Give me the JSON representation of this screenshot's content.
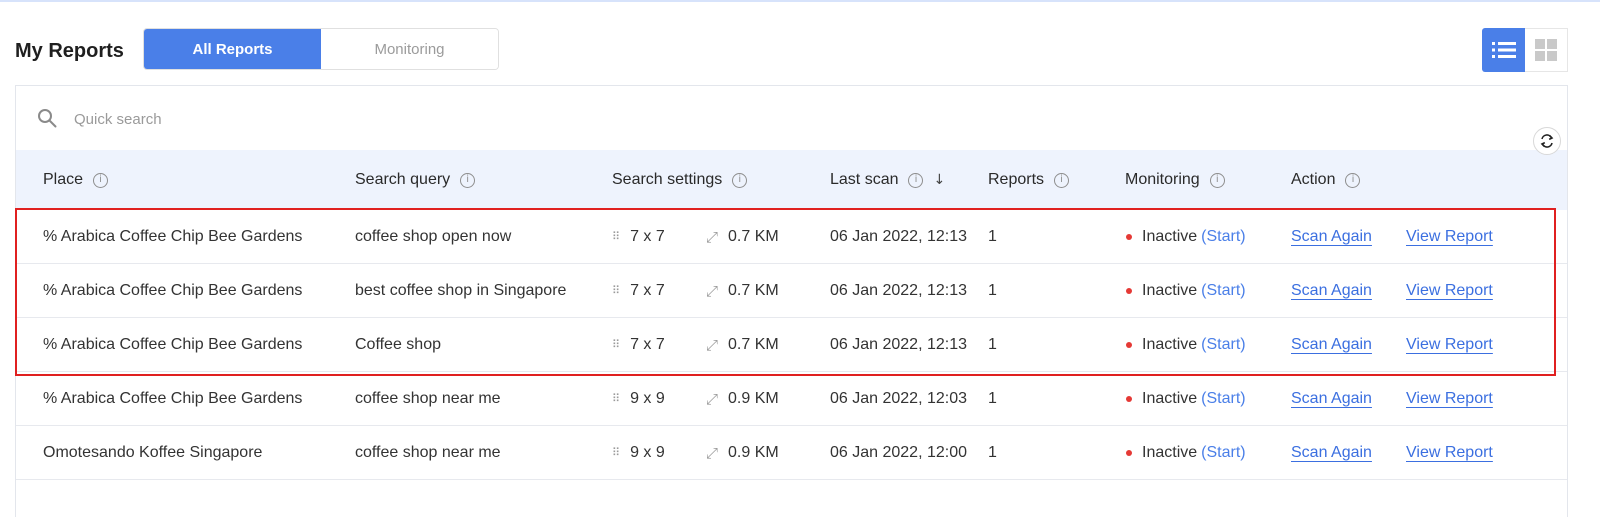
{
  "page": {
    "title": "My Reports"
  },
  "tabs": [
    {
      "label": "All Reports",
      "active": true
    },
    {
      "label": "Monitoring",
      "active": false
    }
  ],
  "view_toggle": {
    "list_icon": "list-view-icon",
    "grid_icon": "grid-view-icon",
    "active": "list"
  },
  "search": {
    "placeholder": "Quick search",
    "value": ""
  },
  "columns": [
    {
      "key": "place",
      "label": "Place"
    },
    {
      "key": "query",
      "label": "Search query"
    },
    {
      "key": "settings",
      "label": "Search settings"
    },
    {
      "key": "last_scan",
      "label": "Last scan",
      "sorted": "desc"
    },
    {
      "key": "reports",
      "label": "Reports"
    },
    {
      "key": "monitoring",
      "label": "Monitoring"
    },
    {
      "key": "action",
      "label": "Action"
    }
  ],
  "rows": [
    {
      "place": "% Arabica Coffee Chip Bee Gardens",
      "query": "coffee shop open now",
      "grid": "7 x 7",
      "radius": "0.7 KM",
      "last_scan": "06 Jan 2022, 12:13",
      "reports": "1",
      "status": "Inactive",
      "start": "(Start)",
      "scan_again": "Scan Again",
      "view_report": "View Report"
    },
    {
      "place": "% Arabica Coffee Chip Bee Gardens",
      "query": "best coffee shop in Singapore",
      "grid": "7 x 7",
      "radius": "0.7 KM",
      "last_scan": "06 Jan 2022, 12:13",
      "reports": "1",
      "status": "Inactive",
      "start": "(Start)",
      "scan_again": "Scan Again",
      "view_report": "View Report"
    },
    {
      "place": "% Arabica Coffee Chip Bee Gardens",
      "query": "Coffee shop",
      "grid": "7 x 7",
      "radius": "0.7 KM",
      "last_scan": "06 Jan 2022, 12:13",
      "reports": "1",
      "status": "Inactive",
      "start": "(Start)",
      "scan_again": "Scan Again",
      "view_report": "View Report"
    },
    {
      "place": "% Arabica Coffee Chip Bee Gardens",
      "query": "coffee shop near me",
      "grid": "9 x 9",
      "radius": "0.9 KM",
      "last_scan": "06 Jan 2022, 12:03",
      "reports": "1",
      "status": "Inactive",
      "start": "(Start)",
      "scan_again": "Scan Again",
      "view_report": "View Report"
    },
    {
      "place": "Omotesando Koffee Singapore",
      "query": "coffee shop near me",
      "grid": "9 x 9",
      "radius": "0.9 KM",
      "last_scan": "06 Jan 2022, 12:00",
      "reports": "1",
      "status": "Inactive",
      "start": "(Start)",
      "scan_again": "Scan Again",
      "view_report": "View Report"
    }
  ],
  "colors": {
    "accent": "#4a7fe8",
    "header_bg": "#eef3fd",
    "status_inactive": "#e53935",
    "highlight": "#e02020"
  }
}
